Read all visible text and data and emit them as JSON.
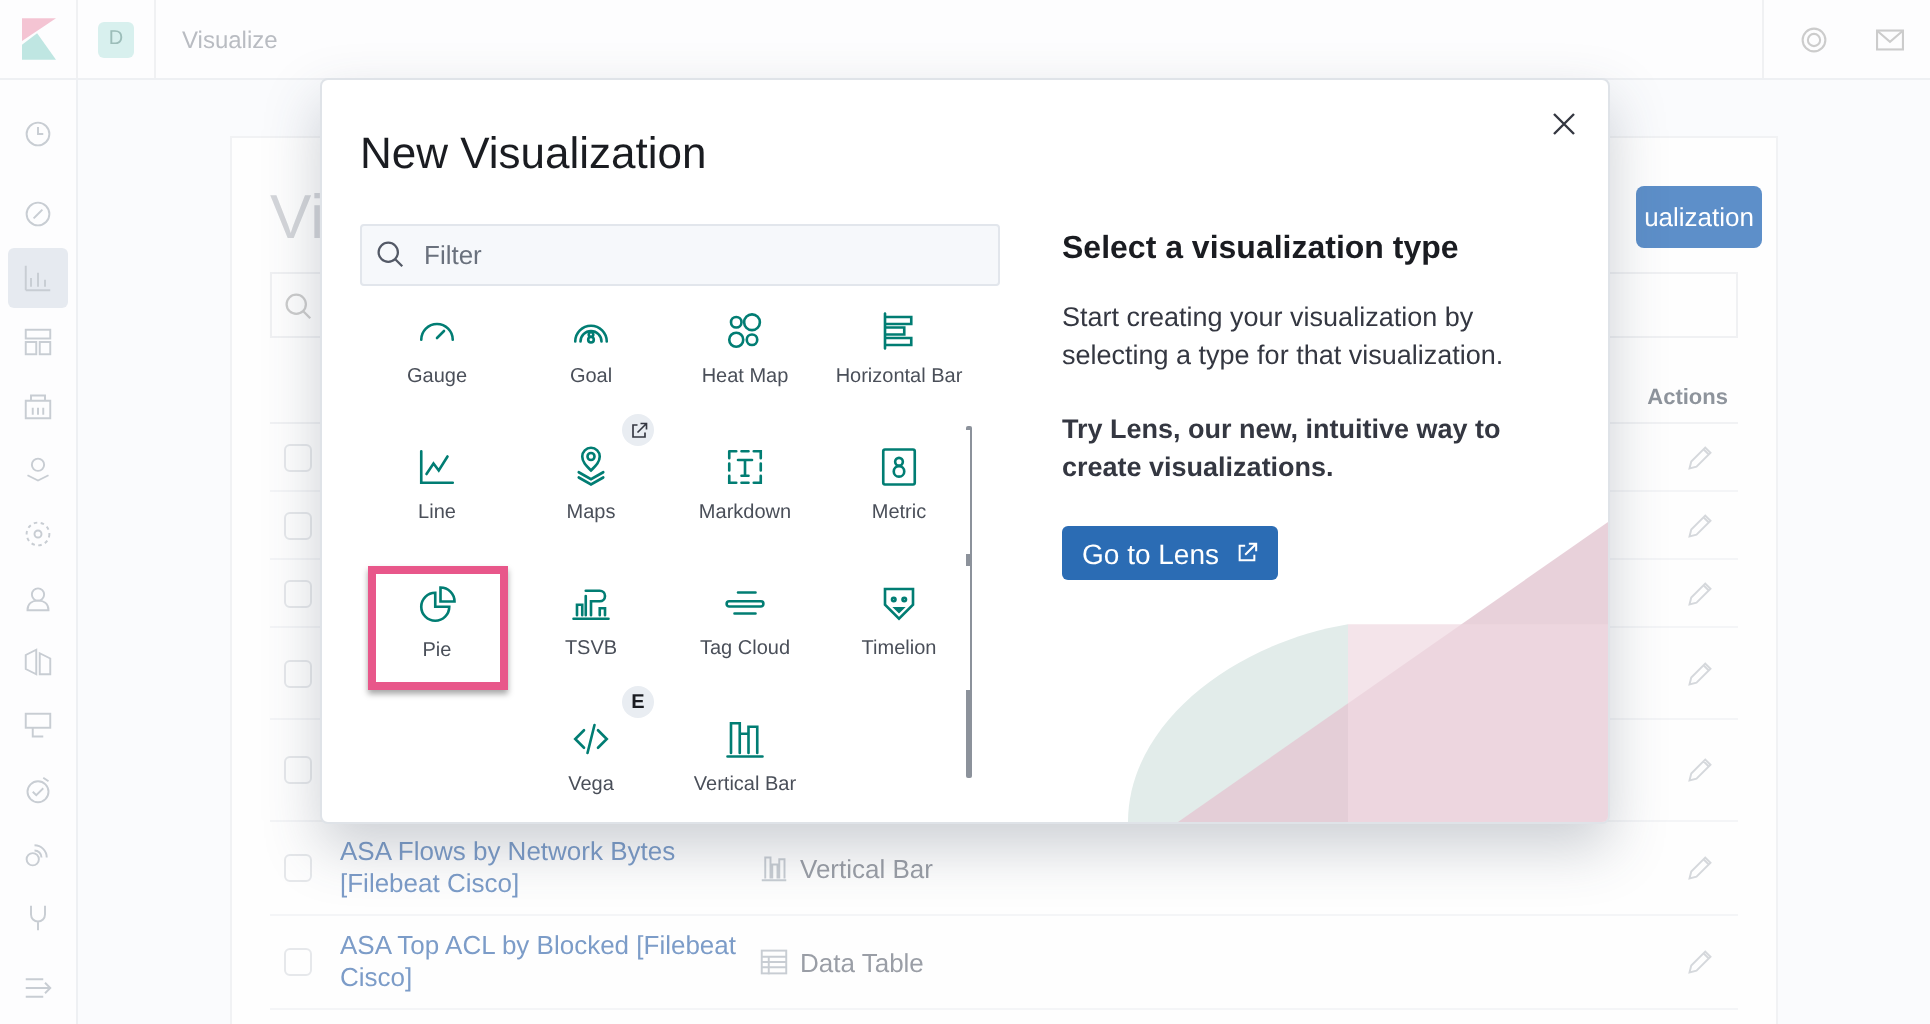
{
  "header": {
    "avatar": "D",
    "breadcrumb": "Visualize"
  },
  "sidebar": {
    "items": [
      {
        "selected": false
      },
      {
        "selected": false
      },
      {
        "selected": true
      },
      {
        "selected": false
      },
      {
        "selected": false
      },
      {
        "selected": false
      },
      {
        "selected": false
      },
      {
        "selected": false
      },
      {
        "selected": false
      },
      {
        "selected": false
      },
      {
        "selected": false
      },
      {
        "selected": false
      },
      {
        "selected": false
      }
    ]
  },
  "page": {
    "title": "Vi",
    "create_button": "ualization",
    "table": {
      "actions_column": "Actions",
      "rows": [
        {
          "checked": false
        },
        {
          "checked": false
        },
        {
          "checked": false
        },
        {
          "checked": false
        },
        {
          "checked": false
        },
        {
          "checked": false,
          "name": "ASA Flows by Network Bytes [Filebeat Cisco]",
          "type": "Vertical Bar",
          "kind": "bar"
        },
        {
          "checked": false,
          "name": "ASA Top ACL by Blocked [Filebeat Cisco]",
          "type": "Data Table",
          "kind": "table"
        }
      ]
    }
  },
  "modal": {
    "title": "New Visualization",
    "filter": {
      "placeholder": "Filter"
    },
    "types": [
      {
        "label": "Gauge",
        "selected": false
      },
      {
        "label": "Goal",
        "selected": false
      },
      {
        "label": "Heat Map",
        "selected": false
      },
      {
        "label": "Horizontal Bar",
        "selected": false
      },
      {
        "label": "Line",
        "selected": false
      },
      {
        "label": "Maps",
        "selected": false,
        "badge": {
          "kind": "external"
        }
      },
      {
        "label": "Markdown",
        "selected": false
      },
      {
        "label": "Metric",
        "selected": false
      },
      {
        "label": "Pie",
        "selected": true
      },
      {
        "label": "TSVB",
        "selected": false
      },
      {
        "label": "Tag Cloud",
        "selected": false
      },
      {
        "label": "Timelion",
        "selected": false
      },
      {
        "label": "Vega",
        "selected": false,
        "badge": {
          "kind": "text",
          "text": "E"
        }
      },
      {
        "label": "Vertical Bar",
        "selected": false
      }
    ],
    "heading": "Select a visualization type",
    "description": "Start creating your visualization by selecting a type for that visualization.",
    "promo": "Try Lens, our new, intuitive way to create visualizations.",
    "lens_button": "Go to Lens"
  }
}
